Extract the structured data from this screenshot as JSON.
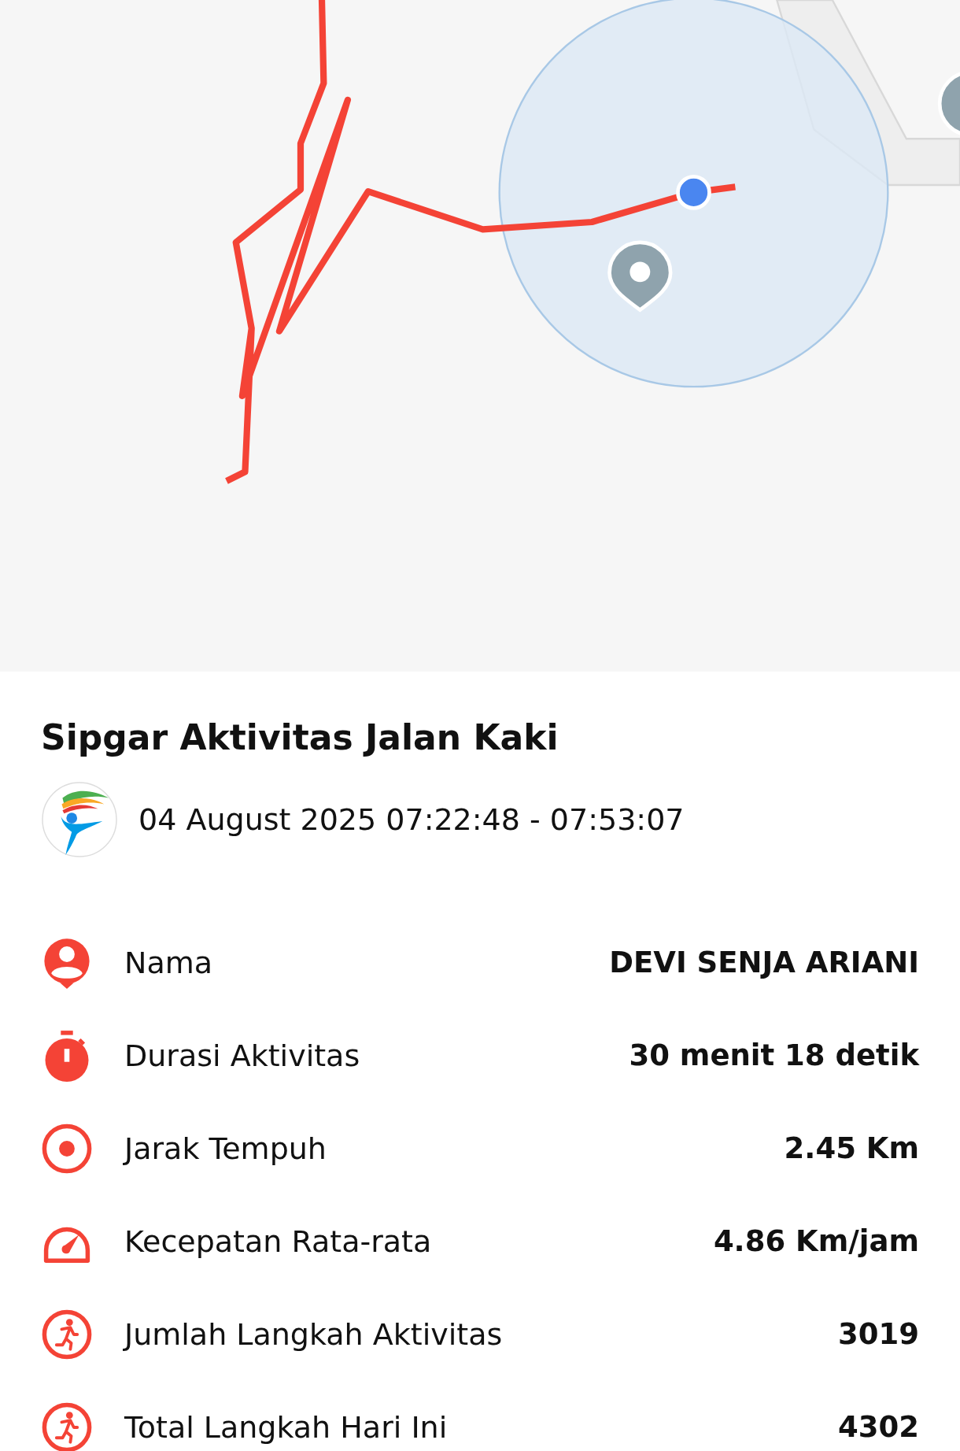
{
  "title": "Sipgar Aktivitas Jalan Kaki",
  "session": {
    "time_range": "04 August 2025 07:22:48 - 07:53:07"
  },
  "stats": [
    {
      "kind": "person",
      "label": "Nama",
      "value": "DEVI SENJA ARIANI"
    },
    {
      "kind": "timer",
      "label": "Durasi Aktivitas",
      "value": "30 menit 18 detik"
    },
    {
      "kind": "target",
      "label": "Jarak Tempuh",
      "value": "2.45 Km"
    },
    {
      "kind": "speed",
      "label": "Kecepatan Rata-rata",
      "value": "4.86 Km/jam"
    },
    {
      "kind": "walker",
      "label": "Jumlah Langkah Aktivitas",
      "value": "3019"
    },
    {
      "kind": "walker",
      "label": "Total Langkah Hari Ini",
      "value": "4302"
    }
  ]
}
